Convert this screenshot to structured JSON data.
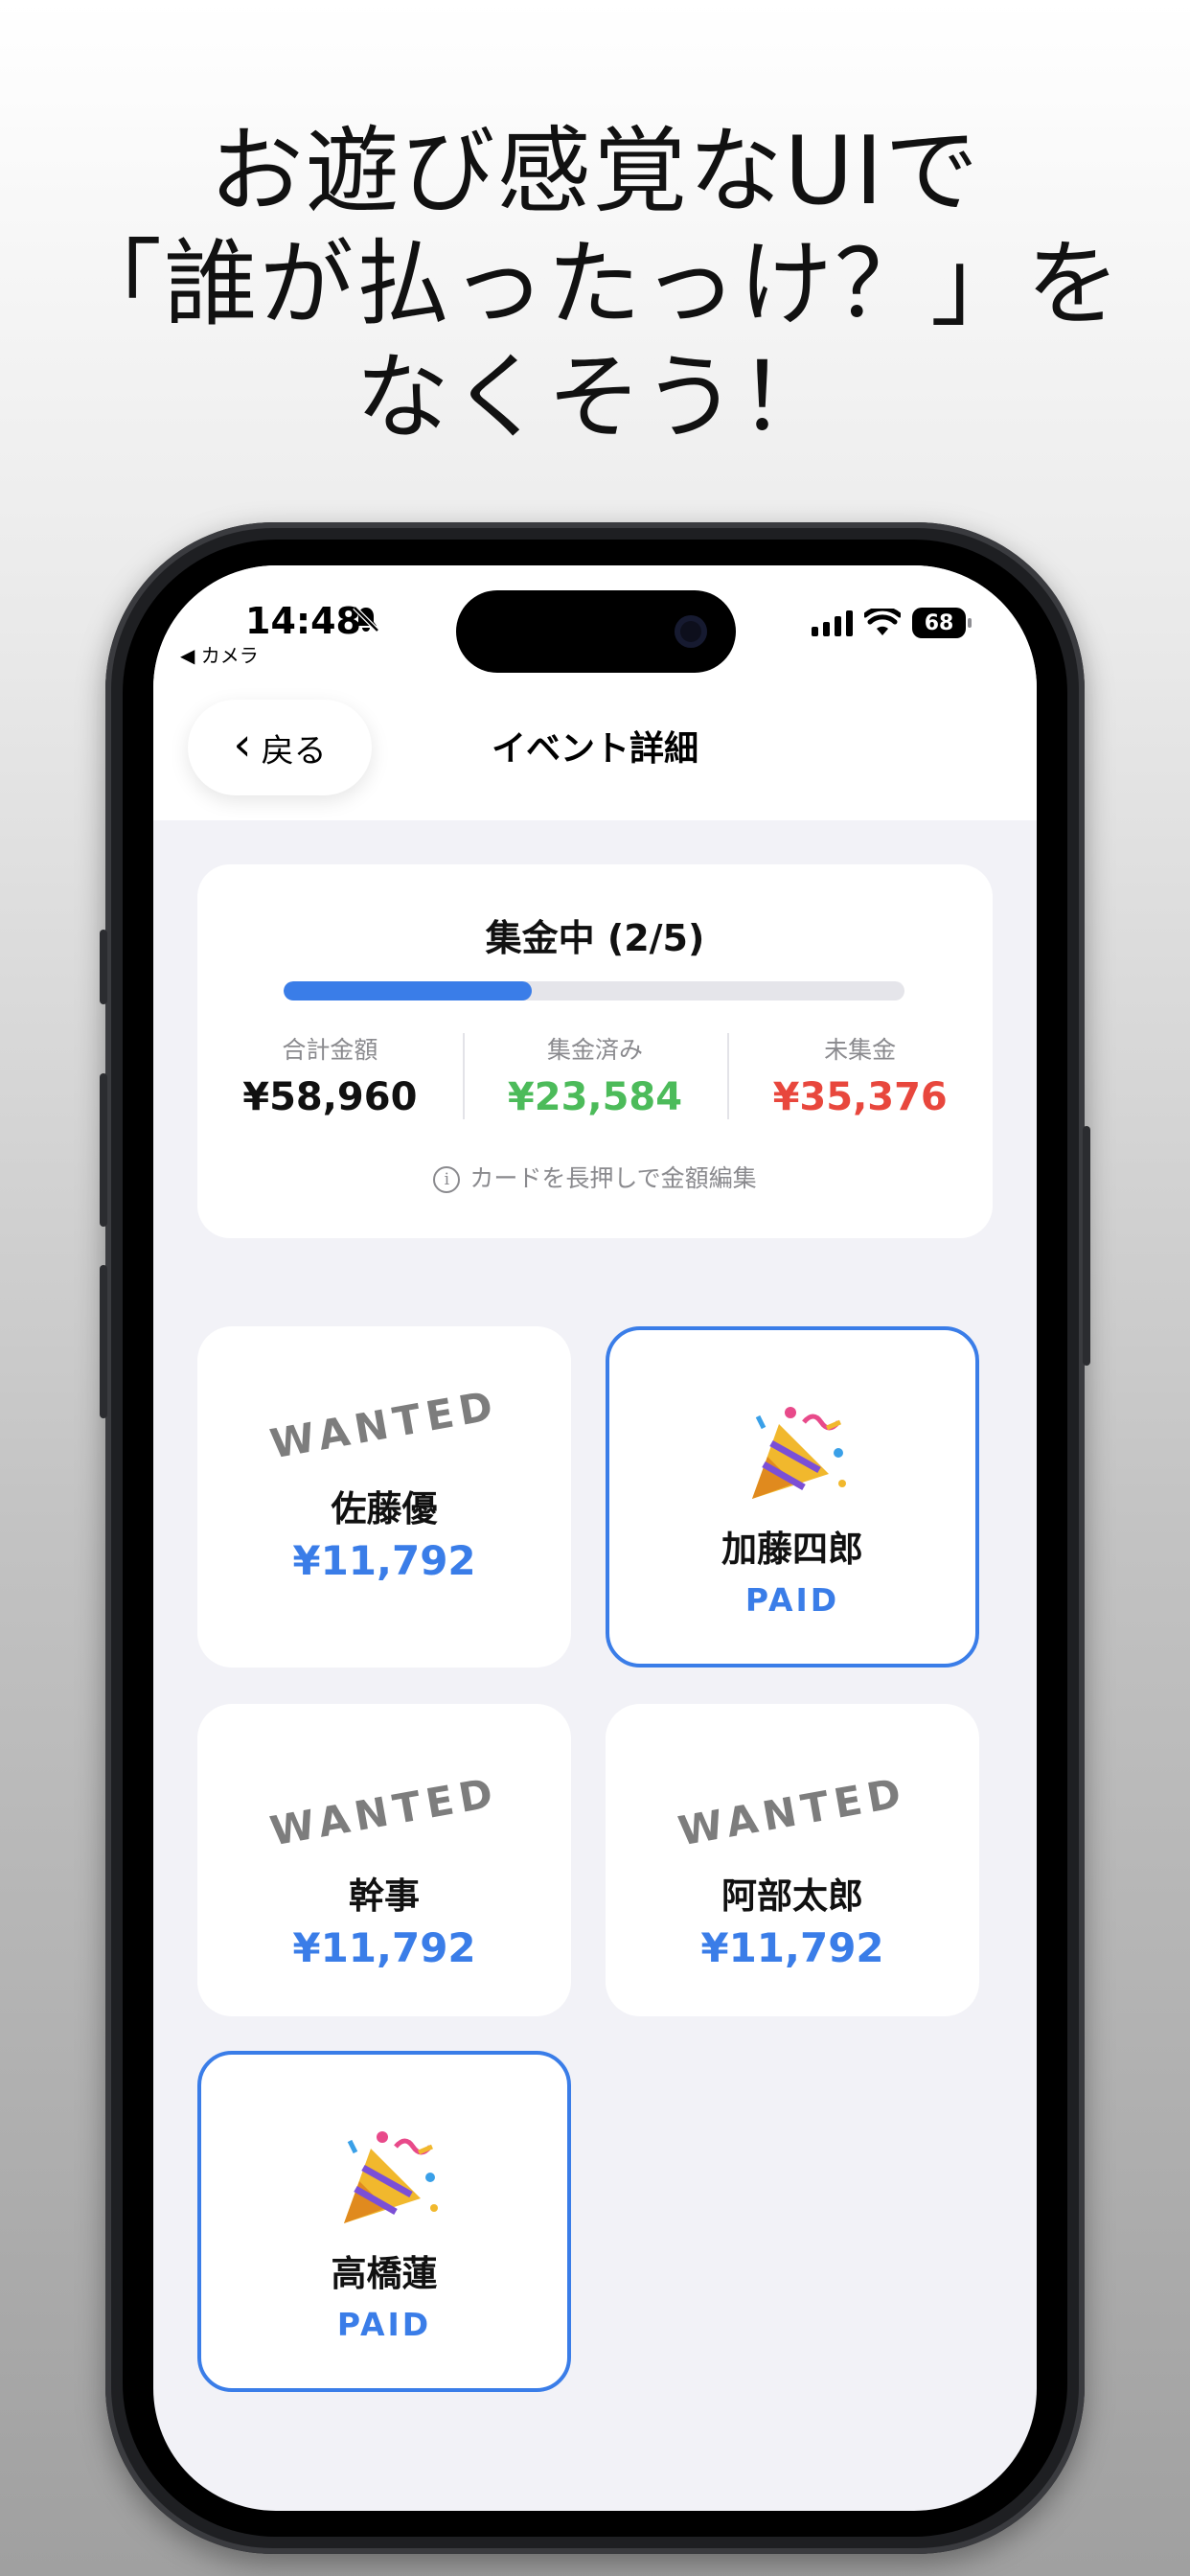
{
  "headline": {
    "line1": "お遊び感覚なUIで",
    "line2": "「誰が払ったっけ？」を",
    "line3": "なくそう！"
  },
  "status_bar": {
    "time": "14:48",
    "back_app": "◀ カメラ",
    "battery": "68"
  },
  "nav": {
    "back_label": "戻る",
    "title": "イベント詳細"
  },
  "summary": {
    "title": "集金中 (2/5)",
    "progress": 0.4,
    "stats": [
      {
        "label": "合計金額",
        "value": "¥58,960",
        "color": "#111111"
      },
      {
        "label": "集金済み",
        "value": "¥23,584",
        "color": "#4cbb5a"
      },
      {
        "label": "未集金",
        "value": "¥35,376",
        "color": "#e8473d"
      }
    ],
    "hint": "カードを長押しで金額編集"
  },
  "members": [
    {
      "name": "佐藤優",
      "status": "wanted",
      "wanted_label": "WANTED",
      "amount": "¥11,792"
    },
    {
      "name": "加藤四郎",
      "status": "paid",
      "paid_label": "PAID",
      "icon": "party-popper-icon"
    },
    {
      "name": "幹事",
      "status": "wanted",
      "wanted_label": "WANTED",
      "amount": "¥11,792"
    },
    {
      "name": "阿部太郎",
      "status": "wanted",
      "wanted_label": "WANTED",
      "amount": "¥11,792"
    },
    {
      "name": "高橋蓮",
      "status": "paid",
      "paid_label": "PAID",
      "icon": "party-popper-icon"
    }
  ],
  "colors": {
    "accent": "#3a7de8",
    "collected": "#4cbb5a",
    "uncollected": "#e8473d"
  }
}
